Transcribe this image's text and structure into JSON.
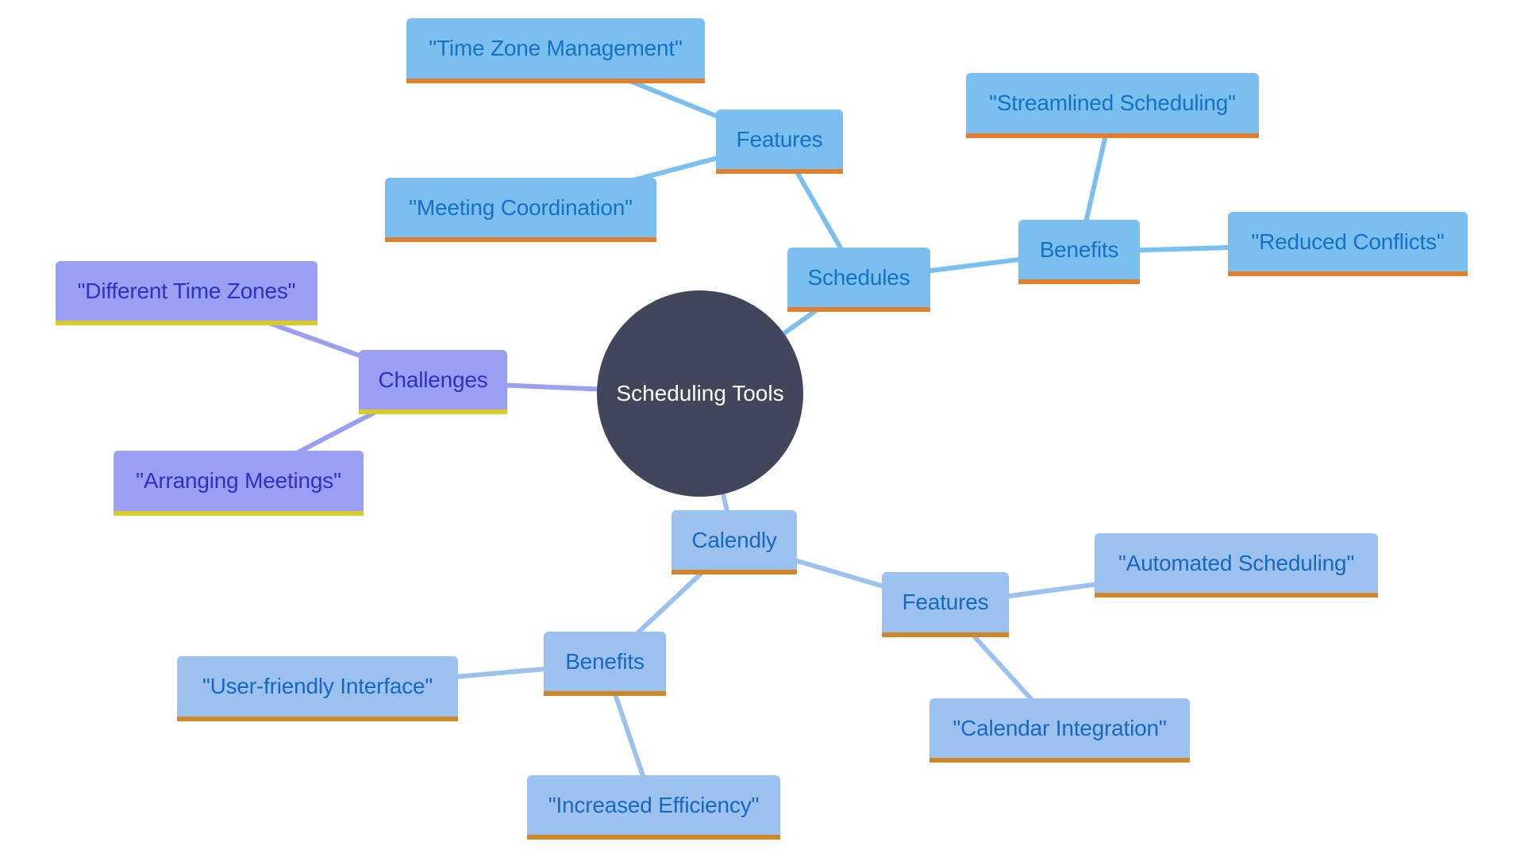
{
  "title": "Scheduling Tools mind map",
  "root": {
    "label": "Scheduling Tools"
  },
  "colors": {
    "root_fill": "#42465c",
    "schedules_fill": "#7bbff0",
    "schedules_text": "#1671c4",
    "schedules_edge": "#7bbff0",
    "calendly_fill": "#9bc2ef",
    "calendly_text": "#1a66c2",
    "calendly_edge": "#9bc2ef",
    "challenges_fill": "#9b9ff2",
    "challenges_text": "#2d31c6",
    "challenges_edge": "#9b9ff2",
    "orange_accent": "#e07f30",
    "yellow_accent": "#d6cc2a"
  },
  "nodes": {
    "schedules": "Schedules",
    "schedules_features": "Features",
    "time_zone_management": "\"Time Zone Management\"",
    "meeting_coordination": "\"Meeting Coordination\"",
    "schedules_benefits": "Benefits",
    "streamlined_scheduling": "\"Streamlined Scheduling\"",
    "reduced_conflicts": "\"Reduced Conflicts\"",
    "challenges": "Challenges",
    "different_time_zones": "\"Different Time Zones\"",
    "arranging_meetings": "\"Arranging Meetings\"",
    "calendly": "Calendly",
    "calendly_features": "Features",
    "automated_scheduling": "\"Automated Scheduling\"",
    "calendar_integration": "\"Calendar Integration\"",
    "calendly_benefits": "Benefits",
    "user_friendly_interface": "\"User-friendly Interface\"",
    "increased_efficiency": "\"Increased Efficiency\""
  },
  "edges": [
    [
      "root",
      "schedules"
    ],
    [
      "schedules",
      "schedules_features"
    ],
    [
      "schedules_features",
      "time_zone_management"
    ],
    [
      "schedules_features",
      "meeting_coordination"
    ],
    [
      "schedules",
      "schedules_benefits"
    ],
    [
      "schedules_benefits",
      "streamlined_scheduling"
    ],
    [
      "schedules_benefits",
      "reduced_conflicts"
    ],
    [
      "root",
      "challenges"
    ],
    [
      "challenges",
      "different_time_zones"
    ],
    [
      "challenges",
      "arranging_meetings"
    ],
    [
      "root",
      "calendly"
    ],
    [
      "calendly",
      "calendly_features"
    ],
    [
      "calendly_features",
      "automated_scheduling"
    ],
    [
      "calendly_features",
      "calendar_integration"
    ],
    [
      "calendly",
      "calendly_benefits"
    ],
    [
      "calendly_benefits",
      "user_friendly_interface"
    ],
    [
      "calendly_benefits",
      "increased_efficiency"
    ]
  ]
}
